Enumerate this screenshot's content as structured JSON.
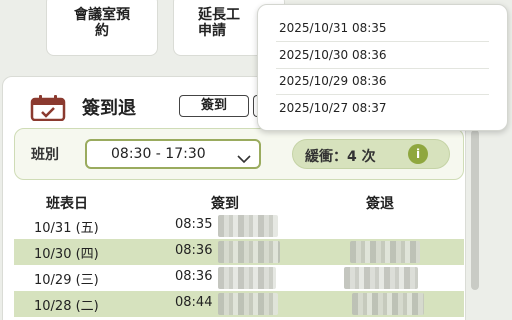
{
  "top_tiles": [
    {
      "line1": "會議室預",
      "line2": "約"
    },
    {
      "line1": "延長工",
      "line2": "申請"
    }
  ],
  "section": {
    "title": "簽到退",
    "checkin_button": "簽到"
  },
  "shift": {
    "label": "班別",
    "value": "08:30 - 17:30",
    "buffer_label": "緩衝：4 次",
    "info_icon": "i"
  },
  "table": {
    "headers": [
      "班表日",
      "簽到",
      "簽退"
    ],
    "rows": [
      {
        "date": "10/31 (五)",
        "checkin": "08:35"
      },
      {
        "date": "10/30 (四)",
        "checkin": "08:36"
      },
      {
        "date": "10/29 (三)",
        "checkin": "08:36"
      },
      {
        "date": "10/28 (二)",
        "checkin": "08:44"
      }
    ]
  },
  "history_dropdown": {
    "items": [
      "2025/10/31 08:35",
      "2025/10/30 08:36",
      "2025/10/29 08:36",
      "2025/10/27 08:37"
    ]
  },
  "colors": {
    "accent_green": "#9aab5e",
    "row_highlight": "#d6e2be",
    "calendar_icon": "#8b3a2f"
  }
}
